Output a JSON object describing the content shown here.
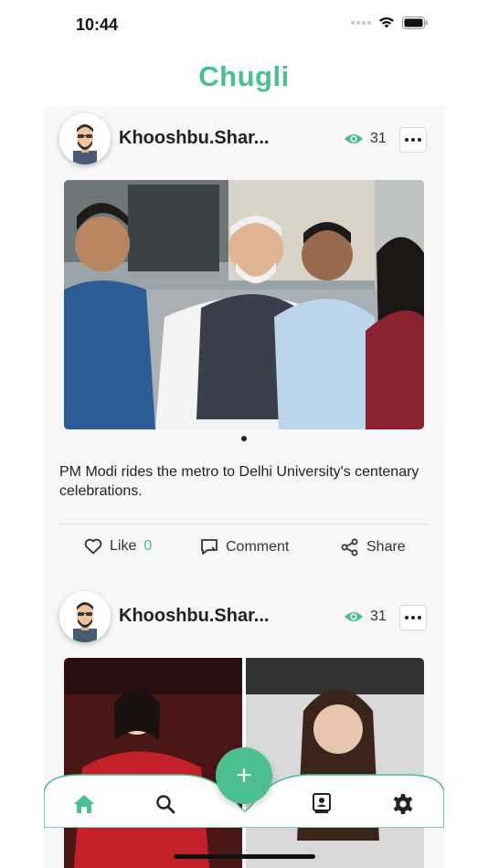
{
  "status_bar": {
    "time": "10:44"
  },
  "app": {
    "title": "Chugli",
    "accent_color": "#4cbf8e"
  },
  "posts": [
    {
      "username": "Khooshbu.Shar...",
      "views": "31",
      "image_alt": "PM Modi with students in metro",
      "caption": "PM Modi rides the metro to Delhi University's centenary celebrations.",
      "actions": {
        "like_label": "Like",
        "like_count": "0",
        "comment_label": "Comment",
        "share_label": "Share"
      }
    },
    {
      "username": "Khooshbu.Shar...",
      "views": "31",
      "image_alt": "Two women portraits"
    }
  ],
  "bottom_nav": {
    "items": [
      {
        "icon": "home-icon",
        "active": true
      },
      {
        "icon": "search-icon",
        "active": false
      },
      {
        "icon": "profile-card-icon",
        "active": false
      },
      {
        "icon": "settings-icon",
        "active": false
      }
    ],
    "fab_label": "+"
  }
}
